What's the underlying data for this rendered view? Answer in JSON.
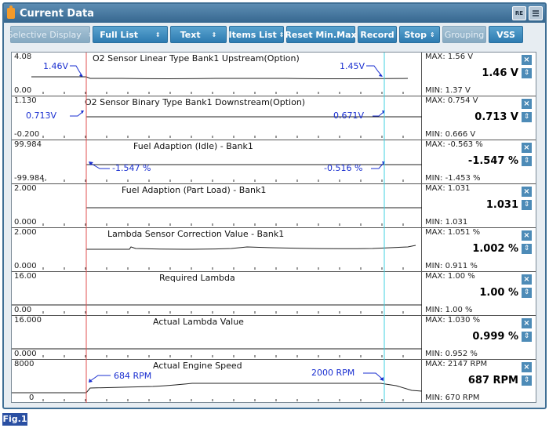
{
  "window": {
    "title": "Current Data"
  },
  "toolbar": [
    {
      "label": "Selective Display",
      "disabled": true,
      "arrow": "⇕"
    },
    {
      "label": "Full List",
      "disabled": false,
      "arrow": "⇕"
    },
    {
      "label": "Text",
      "disabled": false,
      "arrow": "⇕"
    },
    {
      "label": "Items List",
      "disabled": false,
      "arrow": "⇕"
    },
    {
      "label": "Reset Min.Max",
      "disabled": false
    },
    {
      "label": "Record",
      "disabled": false
    },
    {
      "label": "Stop",
      "disabled": false,
      "arrow": "⇕"
    },
    {
      "label": "Grouping",
      "disabled": true
    },
    {
      "label": "VSS",
      "disabled": false
    }
  ],
  "rows": [
    {
      "title": "O2 Sensor Linear Type Bank1 Upstream(Option)",
      "top": "4.08",
      "bottom": "0.00",
      "max": "MAX:  1.56 V",
      "current": "1.46 V",
      "min": "MIN:  1.37 V",
      "annotations": [
        "1.46V",
        "1.45V"
      ]
    },
    {
      "title": "O2 Sensor Binary Type Bank1 Downstream(Option)",
      "top": "1.130",
      "bottom": "-0.200",
      "max": "MAX: 0.754 V",
      "current": "0.713 V",
      "min": "MIN: 0.666 V",
      "annotations": [
        "0.713V",
        "0.671V"
      ]
    },
    {
      "title": "Fuel Adaption (Idle) - Bank1",
      "top": "99.984",
      "bottom": "-99.984,",
      "max": "MAX: -0.563 %",
      "current": "-1.547 %",
      "min": "MIN: -1.453 %",
      "annotations": [
        "-1.547 %",
        "-0.516 %"
      ]
    },
    {
      "title": "Fuel Adaption (Part Load) - Bank1",
      "top": "2.000",
      "bottom": "0.000",
      "max": "MAX: 1.031",
      "current": "1.031",
      "min": "MIN: 1.031",
      "annotations": []
    },
    {
      "title": "Lambda Sensor Correction Value - Bank1",
      "top": "2.000",
      "bottom": "0.000",
      "max": "MAX: 1.051 %",
      "current": "1.002 %",
      "min": "MIN: 0.911 %",
      "annotations": []
    },
    {
      "title": "Required Lambda",
      "top": "16.00",
      "bottom": "0.00",
      "max": "MAX:  1.00 %",
      "current": "1.00 %",
      "min": "MIN:  1.00 %",
      "annotations": []
    },
    {
      "title": "Actual Lambda Value",
      "top": "16.000",
      "bottom": "0.000",
      "max": "MAX: 1.030 %",
      "current": "0.999 %",
      "min": "MIN: 0.952 %",
      "annotations": []
    },
    {
      "title": "Actual Engine Speed",
      "top": "8000",
      "bottom": "0",
      "max": "MAX:  2147 RPM",
      "current": "687 RPM",
      "min": "MIN:  670 RPM",
      "annotations": [
        "684 RPM",
        "2000 RPM"
      ]
    }
  ],
  "figure": {
    "label": "Fig.1"
  },
  "icons": {
    "retry": "retry-icon",
    "menu": "menu-icon",
    "close": "close-icon",
    "scroll": "scroll-icon"
  },
  "colors": {
    "accent": "#2d7bb1",
    "cursor_red": "#e05050",
    "cursor_cyan": "#40d0e0",
    "annotation": "#1a2fd0"
  }
}
